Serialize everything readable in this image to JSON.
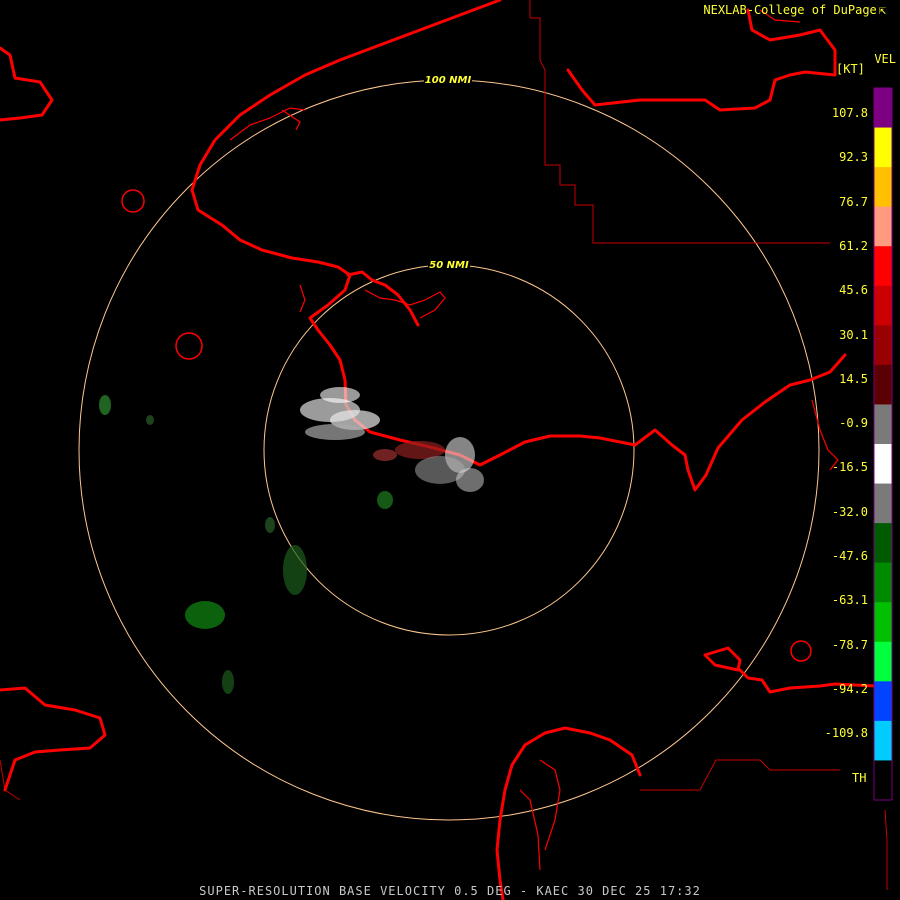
{
  "credit": "NEXLAB-College of DuPage",
  "credit_icon": "cursor-arrow-icon",
  "legend": {
    "title": "VEL",
    "unit": "[KT]",
    "ticks": [
      "107.8",
      "92.3",
      "76.7",
      "61.2",
      "45.6",
      "30.1",
      "14.5",
      "-0.9",
      "-16.5",
      "-32.0",
      "-47.6",
      "-63.1",
      "-78.7",
      "-94.2",
      "-109.8"
    ],
    "threshold_label": "TH",
    "colors": [
      "#7e0082",
      "#ffff00",
      "#ffc000",
      "#ff9980",
      "#ff0000",
      "#cc0000",
      "#990000",
      "#5a0000",
      "#7a7a7a",
      "#ffffff",
      "#7a7a7a",
      "#005a00",
      "#008a00",
      "#00c000",
      "#00ff3c",
      "#0044ff",
      "#00ccff",
      "#000000"
    ]
  },
  "range_rings": {
    "inner_label": "50 NMI",
    "outer_label": "100 NMI",
    "ring_color": "#ffc890"
  },
  "map_colors": {
    "coastline": "#ff0000",
    "border": "#c80000"
  },
  "caption": "SUPER-RESOLUTION BASE VELOCITY 0.5 DEG - KAEC 30 DEC 25 17:32"
}
